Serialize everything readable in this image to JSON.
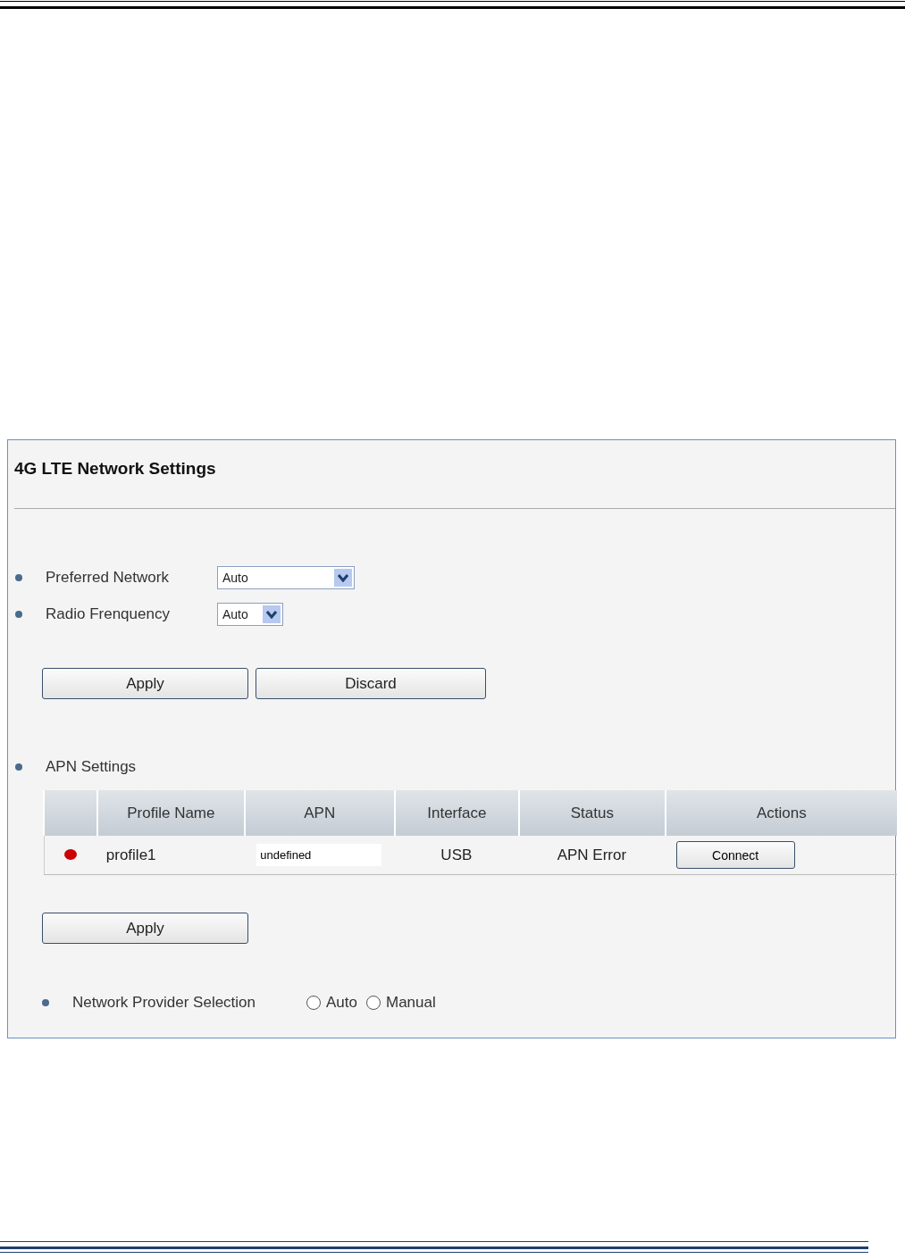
{
  "panel": {
    "title": "4G LTE Network Settings",
    "settings": [
      {
        "label": "Preferred Network",
        "value": "Auto",
        "kind": "wide"
      },
      {
        "label": "Radio Frenquency",
        "value": "Auto",
        "kind": "narrow"
      }
    ],
    "buttons": [
      "Apply",
      "Discard"
    ],
    "apn": {
      "heading": "APN Settings",
      "columns": [
        "Profile Name",
        "APN",
        "Interface",
        "Status",
        "Actions"
      ],
      "rows": [
        {
          "color": "#cc0000",
          "profile": "profile1",
          "apn": "undefined",
          "interface": "USB",
          "status": "APN Error",
          "action": "Connect"
        }
      ],
      "apply": "Apply"
    },
    "provider": {
      "label": "Network Provider Selection",
      "options": [
        {
          "label": "Auto",
          "selected": false
        },
        {
          "label": "Manual",
          "selected": false
        }
      ]
    }
  }
}
